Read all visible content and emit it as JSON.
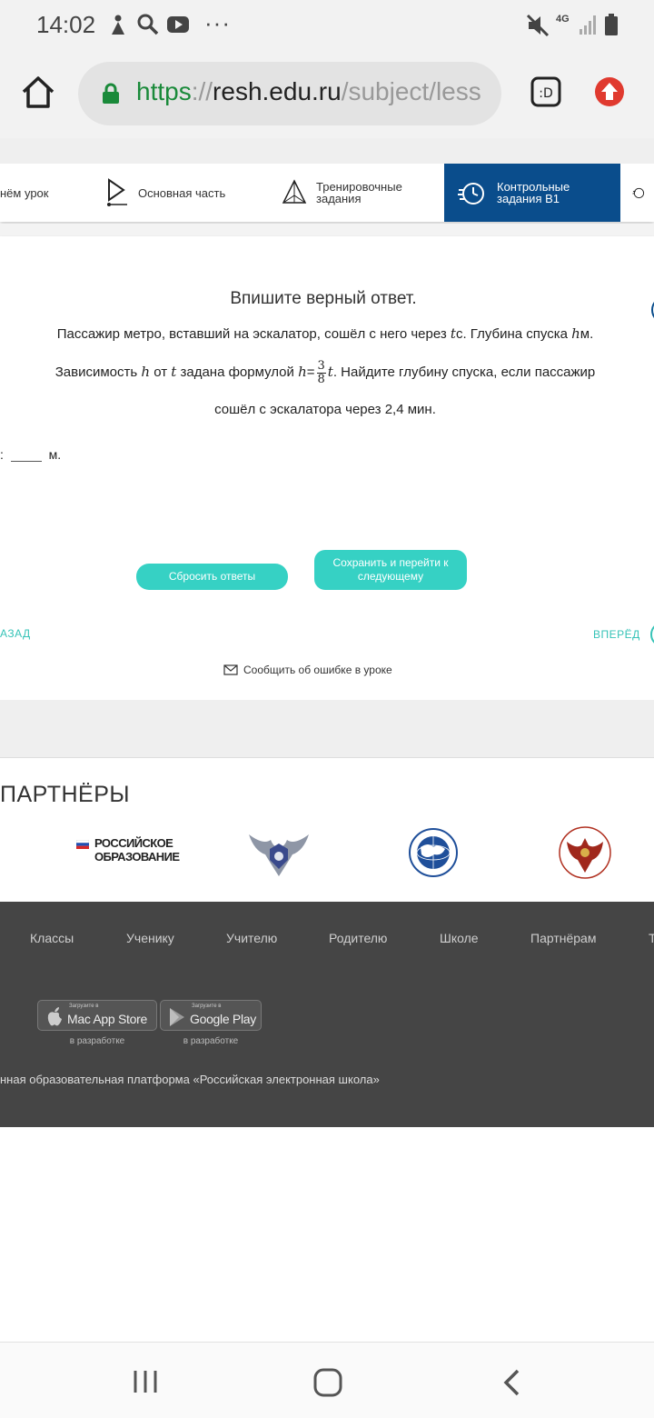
{
  "status_bar": {
    "time": "14:02",
    "dots": "···",
    "network": "4G"
  },
  "browser": {
    "url_scheme": "https",
    "url_sep": "://",
    "url_host": "resh.edu.ru",
    "url_path": "/subject/less"
  },
  "tabs": [
    {
      "label": "нём урок"
    },
    {
      "label": "Основная часть"
    },
    {
      "label": "Тренировочные",
      "label2": "задания"
    },
    {
      "label": "Контрольные",
      "label2": "задания В1"
    }
  ],
  "task": {
    "title": "Впишите верный ответ.",
    "l1a": "Пассажир метро, вставший на эскалатор, сошёл с него через",
    "var_t": "t",
    "l1b": "с. Глубина спуска",
    "var_h": "h",
    "l1c": "м.",
    "l2a": "Зависимость",
    "l2b": "от",
    "l2c": "задана формулой",
    "eq": "=",
    "frac_num": "3",
    "frac_den": "8",
    "l2d": ". Найдите глубину спуска, если пассажир",
    "l3": "сошёл с эскалатора через 2,4 мин.",
    "answer_prefix": ":",
    "answer_value": "",
    "answer_unit": "м."
  },
  "buttons": {
    "reset": "Сбросить ответы",
    "save_l1": "Сохранить и перейти к",
    "save_l2": "следующему"
  },
  "nav": {
    "back": "АЗАД",
    "forward": "ВПЕРЁД"
  },
  "report_error": "Сообщить об ошибке в уроке",
  "partners": {
    "title": "ПАРТНЁРЫ",
    "ro_line1": "РОССИЙСКОЕ",
    "ro_line2": "ОБРАЗОВАНИЕ"
  },
  "footer": {
    "links": [
      "Классы",
      "Ученику",
      "Учителю",
      "Родителю",
      "Школе",
      "Партнёрам",
      "Т"
    ],
    "appstore_small": "Загрузите в",
    "appstore_name": "Mac App Store",
    "googleplay_small": "Загрузите в",
    "googleplay_name": "Google Play",
    "in_dev": "в разработке",
    "copyright": "нная образовательная платформа «Российская электронная школа»"
  },
  "colors": {
    "accent": "#36d1c4",
    "tab_active": "#0a4d8c",
    "footer_bg": "#454545",
    "url_green": "#1a8a3a"
  }
}
